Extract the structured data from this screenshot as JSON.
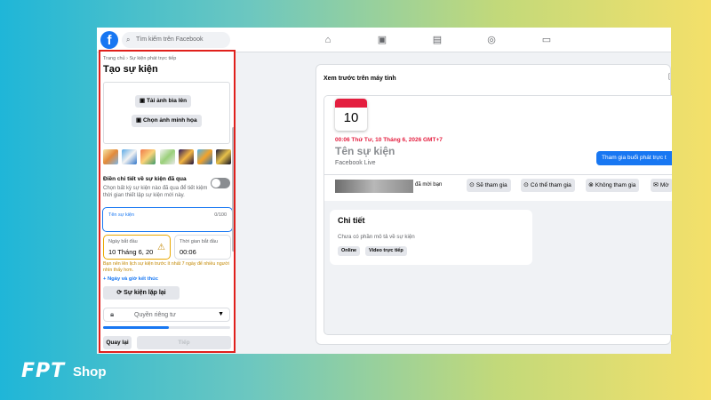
{
  "topbar": {
    "logo": "f",
    "search_placeholder": "Tìm kiếm trên Facebook",
    "nav_icons": [
      "home-icon",
      "watch-icon",
      "marketplace-icon",
      "groups-icon",
      "gaming-icon"
    ]
  },
  "form": {
    "breadcrumb": "Trang chủ › Sự kiện phát trực tiếp",
    "title": "Tạo sự kiện",
    "upload_cover": "Tải ảnh bìa lên",
    "choose_illustration": "Chọn ảnh minh họa",
    "past_event_label": "Điền chi tiết về sự kiện đã qua",
    "past_event_desc": "Chọn bất kỳ sự kiện nào đã qua để tiết kiệm thời gian thiết lập sự kiện mới này.",
    "event_name_label": "Tên sự kiện",
    "event_name_count": "0/100",
    "start_date_label": "Ngày bắt đầu",
    "start_date_value": "10 Tháng 6, 20",
    "start_time_label": "Thời gian bắt đầu",
    "start_time_value": "00:06",
    "warning": "Bạn nên lên lịch sự kiện trước ít nhất 7 ngày để nhiều người nhìn thấy hơn.",
    "end_link": "+ Ngày và giờ kết thúc",
    "repeat_button": "Sự kiện lặp lại",
    "privacy_label": "Quyền riêng tư",
    "progress": 0.52,
    "back_button": "Quay lại",
    "next_button": "Tiếp"
  },
  "preview": {
    "title": "Xem trước trên máy tính",
    "corner": "[",
    "calendar_day": "10",
    "event_datetime": "00:06 Thứ Tư, 10 Tháng 6, 2026 GMT+7",
    "event_name": "Tên sự kiện",
    "event_host": "Facebook Live",
    "join_button": "Tham gia buổi phát trực t",
    "invited_text": "đã mời bạn",
    "rsvp": [
      "Sẽ tham gia",
      "Có thể tham gia",
      "Không tham gia",
      "Mờ"
    ],
    "details_title": "Chi tiết",
    "details_text": "Chưa có phần mô tả về sự kiện",
    "tags": [
      "Online",
      "Video trực tiếp"
    ]
  },
  "brand": {
    "letters": "FPT",
    "shop": "Shop"
  },
  "colors": {
    "facebook_blue": "#1877f2",
    "highlight_red": "#e0201c",
    "date_red": "#e41e3f",
    "warning_amber": "#c28700"
  }
}
